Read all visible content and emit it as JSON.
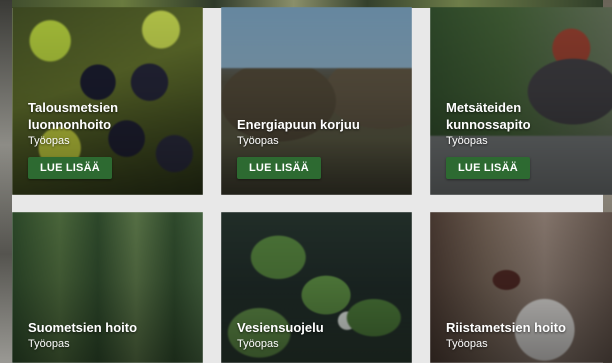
{
  "cards": [
    {
      "title": "Talousmetsien\nluonnonhoito",
      "subtitle": "Työopas",
      "button": "LUE LISÄÄ"
    },
    {
      "title": "Energiapuun korjuu",
      "subtitle": "Työopas",
      "button": "LUE LISÄÄ"
    },
    {
      "title": "Metsäteiden\nkunnossapito",
      "subtitle": "Työopas",
      "button": "LUE LISÄÄ"
    },
    {
      "title": "Suometsien hoito",
      "subtitle": "Työopas"
    },
    {
      "title": "Vesiensuojelu",
      "subtitle": "Työopas"
    },
    {
      "title": "Riistametsien hoito",
      "subtitle": "Työopas"
    }
  ]
}
